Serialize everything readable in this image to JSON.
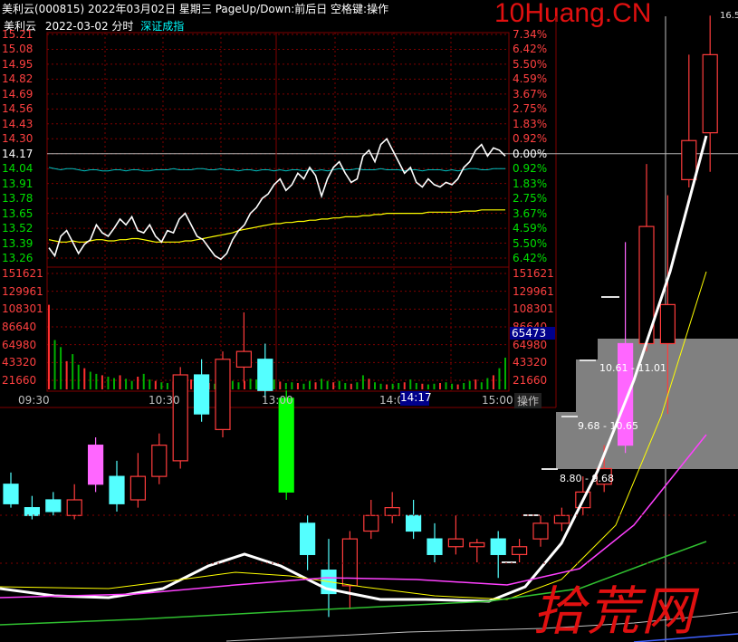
{
  "header": {
    "title": "美利云(000815) 2022年03月02日 星期三 PageUp/Down:前后日 空格键:操作",
    "watermark": "10Huang.CN",
    "right_edge_value": "16.5"
  },
  "subheader": {
    "stock_name": "美利云",
    "date_label": "2022-03-02 分时",
    "index_link": "深证成指"
  },
  "intraday": {
    "price_levels": [
      "15.21",
      "15.08",
      "14.95",
      "14.82",
      "14.69",
      "14.56",
      "14.43",
      "14.30",
      "14.17",
      "14.04",
      "13.91",
      "13.78",
      "13.65",
      "13.52",
      "13.39",
      "13.26"
    ],
    "pct_levels": [
      "7.34%",
      "6.42%",
      "5.50%",
      "4.59%",
      "3.67%",
      "2.75%",
      "1.83%",
      "0.92%",
      "0.00%",
      "0.92%",
      "1.83%",
      "2.75%",
      "3.67%",
      "4.59%",
      "5.50%",
      "6.42%"
    ],
    "volume_levels": [
      "151621",
      "129961",
      "108301",
      "86640",
      "64980",
      "43320",
      "21660"
    ],
    "time_labels": [
      "09:30",
      "10:30",
      "13:00",
      "14:00",
      "15:00"
    ],
    "cursor_time": "14:17",
    "cursor_volume": "65473",
    "ops_button": "操作",
    "prev_close": 14.17,
    "price_series": [
      13.35,
      13.28,
      13.45,
      13.5,
      13.4,
      13.3,
      13.38,
      13.42,
      13.55,
      13.48,
      13.45,
      13.52,
      13.6,
      13.55,
      13.62,
      13.5,
      13.48,
      13.55,
      13.45,
      13.4,
      13.5,
      13.48,
      13.6,
      13.65,
      13.55,
      13.45,
      13.42,
      13.35,
      13.28,
      13.25,
      13.3,
      13.42,
      13.5,
      13.55,
      13.65,
      13.7,
      13.78,
      13.82,
      13.9,
      13.95,
      13.85,
      13.9,
      14.0,
      13.95,
      14.05,
      13.98,
      13.8,
      13.95,
      14.05,
      14.1,
      14.0,
      13.92,
      13.95,
      14.15,
      14.2,
      14.1,
      14.25,
      14.3,
      14.2,
      14.1,
      14.0,
      14.05,
      13.92,
      13.88,
      13.95,
      13.9,
      13.88,
      13.92,
      13.9,
      13.95,
      14.05,
      14.1,
      14.2,
      14.25,
      14.15,
      14.22,
      14.2,
      14.15
    ],
    "avg_series": [
      13.42,
      13.41,
      13.4,
      13.4,
      13.41,
      13.4,
      13.4,
      13.41,
      13.42,
      13.42,
      13.41,
      13.41,
      13.42,
      13.42,
      13.43,
      13.43,
      13.42,
      13.41,
      13.4,
      13.4,
      13.4,
      13.4,
      13.4,
      13.41,
      13.41,
      13.42,
      13.43,
      13.44,
      13.45,
      13.46,
      13.47,
      13.48,
      13.5,
      13.51,
      13.52,
      13.53,
      13.54,
      13.55,
      13.56,
      13.56,
      13.57,
      13.57,
      13.58,
      13.58,
      13.59,
      13.59,
      13.6,
      13.6,
      13.61,
      13.61,
      13.62,
      13.62,
      13.62,
      13.63,
      13.63,
      13.64,
      13.64,
      13.65,
      13.65,
      13.65,
      13.65,
      13.65,
      13.65,
      13.65,
      13.66,
      13.66,
      13.66,
      13.66,
      13.66,
      13.66,
      13.67,
      13.67,
      13.67,
      13.68,
      13.68,
      13.68,
      13.68,
      13.68
    ],
    "index_series": [
      14.05,
      14.04,
      14.03,
      14.04,
      14.04,
      14.03,
      14.02,
      14.03,
      14.03,
      14.02,
      14.02,
      14.03,
      14.03,
      14.02,
      14.03,
      14.03,
      14.02,
      14.02,
      14.03,
      14.03,
      14.03,
      14.04,
      14.03,
      14.03,
      14.03,
      14.04,
      14.04,
      14.03,
      14.03,
      14.04,
      14.03,
      14.03,
      14.02,
      14.03,
      14.03,
      14.02,
      14.03,
      14.03,
      14.02,
      14.03,
      14.02,
      14.03,
      14.03,
      14.02,
      14.03,
      14.02,
      14.03,
      14.02,
      14.03,
      14.04,
      14.03,
      14.03,
      14.04,
      14.03,
      14.03,
      14.03,
      14.04,
      14.03,
      14.03,
      14.03,
      14.02,
      14.03,
      14.03,
      14.02,
      14.03,
      14.03,
      14.03,
      14.02,
      14.03,
      14.02,
      14.03,
      14.04,
      14.04,
      14.03,
      14.03,
      14.04,
      14.04,
      14.04
    ],
    "volume_series": [
      120000,
      70000,
      60000,
      40000,
      50000,
      35000,
      30000,
      25000,
      22000,
      20000,
      18000,
      16000,
      20000,
      15000,
      12000,
      18000,
      22000,
      14000,
      12000,
      10000,
      9000,
      11000,
      12000,
      18000,
      14000,
      12000,
      10000,
      9000,
      8000,
      9000,
      11000,
      12000,
      10000,
      12000,
      15000,
      14000,
      10000,
      12000,
      14000,
      11000,
      9000,
      10000,
      9000,
      8000,
      12000,
      10000,
      15000,
      12000,
      10000,
      12000,
      9000,
      8000,
      10000,
      20000,
      15000,
      10000,
      8000,
      7000,
      8000,
      9000,
      10000,
      14000,
      9000,
      8000,
      7000,
      8000,
      9000,
      10000,
      8000,
      7000,
      9000,
      12000,
      14000,
      10000,
      16000,
      20000,
      30000,
      45000
    ]
  },
  "order_book": {
    "band_labels": [
      "10.61 - 11.01",
      "9.68 - 10.65",
      "8.80 - 9.68"
    ]
  },
  "daily": {
    "candles": [
      {
        "o": 14.3,
        "c": 14.05,
        "h": 14.45,
        "l": 14.0
      },
      {
        "o": 14.0,
        "c": 13.9,
        "h": 14.15,
        "l": 13.85
      },
      {
        "o": 14.1,
        "c": 13.95,
        "h": 14.2,
        "l": 13.9
      },
      {
        "o": 13.9,
        "c": 14.1,
        "h": 14.3,
        "l": 13.85
      },
      {
        "o": 14.3,
        "c": 14.8,
        "h": 14.9,
        "l": 14.2
      },
      {
        "o": 14.4,
        "c": 14.05,
        "h": 14.6,
        "l": 13.95
      },
      {
        "o": 14.1,
        "c": 14.4,
        "h": 14.7,
        "l": 14.0
      },
      {
        "o": 14.4,
        "c": 14.8,
        "h": 14.95,
        "l": 14.3
      },
      {
        "o": 14.6,
        "c": 15.7,
        "h": 15.8,
        "l": 14.5
      },
      {
        "o": 15.7,
        "c": 15.2,
        "h": 15.9,
        "l": 15.1
      },
      {
        "o": 15.0,
        "c": 15.9,
        "h": 16.0,
        "l": 14.9
      },
      {
        "o": 15.8,
        "c": 16.0,
        "h": 16.5,
        "l": 15.6
      },
      {
        "o": 15.9,
        "c": 15.5,
        "h": 16.1,
        "l": 15.4
      },
      {
        "o": 15.4,
        "c": 14.2,
        "h": 15.5,
        "l": 14.1
      },
      {
        "o": 13.8,
        "c": 13.4,
        "h": 13.9,
        "l": 13.2
      },
      {
        "o": 13.2,
        "c": 12.9,
        "h": 13.6,
        "l": 12.6
      },
      {
        "o": 13.0,
        "c": 13.6,
        "h": 13.7,
        "l": 12.7
      },
      {
        "o": 13.7,
        "c": 13.9,
        "h": 14.1,
        "l": 13.6
      },
      {
        "o": 13.9,
        "c": 14.0,
        "h": 14.2,
        "l": 13.8
      },
      {
        "o": 13.9,
        "c": 13.7,
        "h": 14.1,
        "l": 13.6
      },
      {
        "o": 13.6,
        "c": 13.4,
        "h": 13.8,
        "l": 13.3
      },
      {
        "o": 13.5,
        "c": 13.6,
        "h": 13.9,
        "l": 13.4
      },
      {
        "o": 13.5,
        "c": 13.55,
        "h": 13.6,
        "l": 13.3
      },
      {
        "o": 13.6,
        "c": 13.4,
        "h": 13.7,
        "l": 13.1
      },
      {
        "o": 13.4,
        "c": 13.5,
        "h": 13.6,
        "l": 13.3
      },
      {
        "o": 13.6,
        "c": 13.8,
        "h": 13.9,
        "l": 13.5
      },
      {
        "o": 13.8,
        "c": 13.9,
        "h": 14.0,
        "l": 13.7
      },
      {
        "o": 14.0,
        "c": 14.2,
        "h": 14.4,
        "l": 13.9
      },
      {
        "o": 14.3,
        "c": 14.5,
        "h": 14.8,
        "l": 14.2
      },
      {
        "o": 14.8,
        "c": 16.1,
        "h": 17.4,
        "l": 14.7
      },
      {
        "o": 16.1,
        "c": 17.6,
        "h": 18.4,
        "l": 16.0
      },
      {
        "o": 16.1,
        "c": 16.6,
        "h": 18.0,
        "l": 15.2
      },
      {
        "o": 18.2,
        "c": 18.7,
        "h": 19.8,
        "l": 18.1
      },
      {
        "o": 18.8,
        "c": 19.8,
        "h": 20.3,
        "l": 18.3
      }
    ]
  },
  "slogan": "拾荒网",
  "colors": {
    "up": "#ff3c3c",
    "down": "#54ffff",
    "grid": "#800000",
    "price_line": "#ffffff",
    "avg_line": "#ffff00",
    "index_line": "#00c0c0",
    "volume_bar": "#00b000",
    "pink": "#ff66ff",
    "green": "#00ff00"
  }
}
